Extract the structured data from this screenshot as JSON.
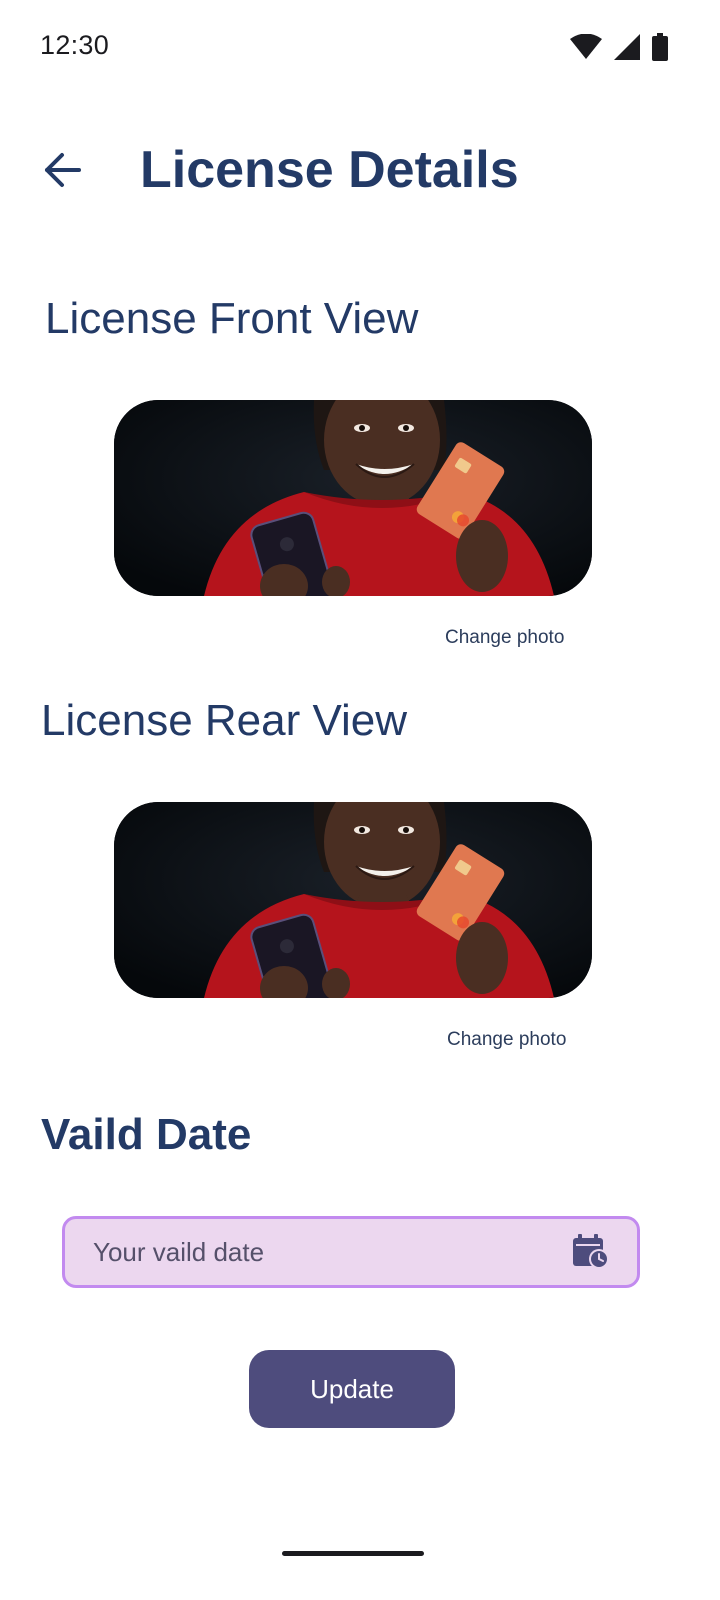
{
  "status_bar": {
    "time": "12:30"
  },
  "header": {
    "title": "License Details",
    "back_icon": "arrow-back-icon"
  },
  "front_view": {
    "heading": "License Front View",
    "change_photo_label": "Change photo"
  },
  "rear_view": {
    "heading": "License Rear View",
    "change_photo_label": "Change photo"
  },
  "valid_date": {
    "heading": "Vaild Date",
    "placeholder": "Your vaild date",
    "icon": "calendar-clock-icon"
  },
  "actions": {
    "update_label": "Update"
  },
  "colors": {
    "primary_text": "#233a66",
    "field_border": "#c28aef",
    "field_background": "#ecd7ef",
    "button_background": "#4e4c7d"
  }
}
